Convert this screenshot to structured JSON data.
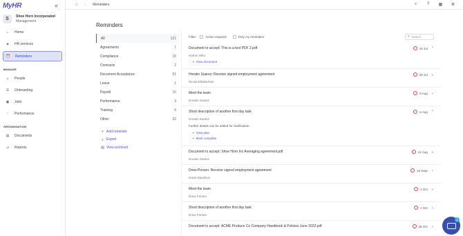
{
  "sidebar": {
    "logo": "MyHR",
    "org_initial": "S",
    "org_name": "Shoe Horn Incorperated",
    "org_role": "Management",
    "items_top": [
      {
        "label": "Home",
        "icon": "home-icon"
      },
      {
        "label": "HR services",
        "icon": "hr-services-icon"
      },
      {
        "label": "Reminders",
        "icon": "reminders-icon",
        "active": true
      }
    ],
    "manage_label": "MANAGE",
    "items_manage": [
      {
        "label": "People",
        "icon": "people-icon"
      },
      {
        "label": "Onboarding",
        "icon": "onboarding-icon"
      },
      {
        "label": "Jobs",
        "icon": "jobs-icon"
      },
      {
        "label": "Performance",
        "icon": "performance-icon"
      }
    ],
    "organisation_label": "ORGANISATION",
    "items_org": [
      {
        "label": "Documents",
        "icon": "documents-icon"
      },
      {
        "label": "Reports",
        "icon": "reports-icon"
      }
    ]
  },
  "topbar": {
    "breadcrumb": "Reminders"
  },
  "page": {
    "title": "Reminders"
  },
  "filters": [
    {
      "label": "All",
      "count": "121"
    },
    {
      "label": "Agreements",
      "count": "7"
    },
    {
      "label": "Compliance",
      "count": "10"
    },
    {
      "label": "Contracts",
      "count": "2"
    },
    {
      "label": "Document Acceptance",
      "count": "51"
    },
    {
      "label": "Leave",
      "count": "1"
    },
    {
      "label": "Payroll",
      "count": "10"
    },
    {
      "label": "Performance",
      "count": "3"
    },
    {
      "label": "Training",
      "count": "5"
    },
    {
      "label": "Other",
      "count": "32"
    }
  ],
  "side_actions": {
    "add": "Add reminder",
    "export": "Export",
    "archived": "View archived"
  },
  "filter_bar": {
    "label": "Filter:",
    "action_required": "Action required",
    "only_mine": "Only my reminders",
    "search_placeholder": "Search"
  },
  "reminders": [
    {
      "title": "Document to accept: This is a test PDF 2.pdf",
      "person": "Horton Who",
      "date": "15 Jul",
      "expanded": true,
      "links": [
        "View document"
      ]
    },
    {
      "title": "Horatio Suarez: Receive signed employment agreement",
      "person": "Nicola Elkaberhan",
      "date": "29 Jul"
    },
    {
      "title": "Meet the team",
      "person": "Horatio Suarez",
      "date": "6 Aug"
    },
    {
      "title": "Short description of another first day task",
      "person": "Horatio Suarez",
      "date": "6 Aug",
      "expanded": true,
      "desc": "Further details can be added for clarification.",
      "links": [
        "View plan",
        "Mark complete"
      ]
    },
    {
      "title": "Document to accept: Shoe Horn Inc Averaging agreement.pdf",
      "person": "Horatio Suarez",
      "date": "12 Aug"
    },
    {
      "title": "Drew Porsen: Receive signed employment agreement",
      "person": "Grant Davidson",
      "date": "23 Sept"
    },
    {
      "title": "Meet the team",
      "person": "Drew Porsen",
      "date": "1 Oct"
    },
    {
      "title": "Short description of another first day task",
      "person": "Drew Porsen",
      "date": "1 Oct"
    },
    {
      "title": "Document to accept: ACME Produce Co Company Handbook & Policies June 2022.pdf",
      "person": "",
      "date": "28 Oct"
    }
  ],
  "chat_badge": "1"
}
